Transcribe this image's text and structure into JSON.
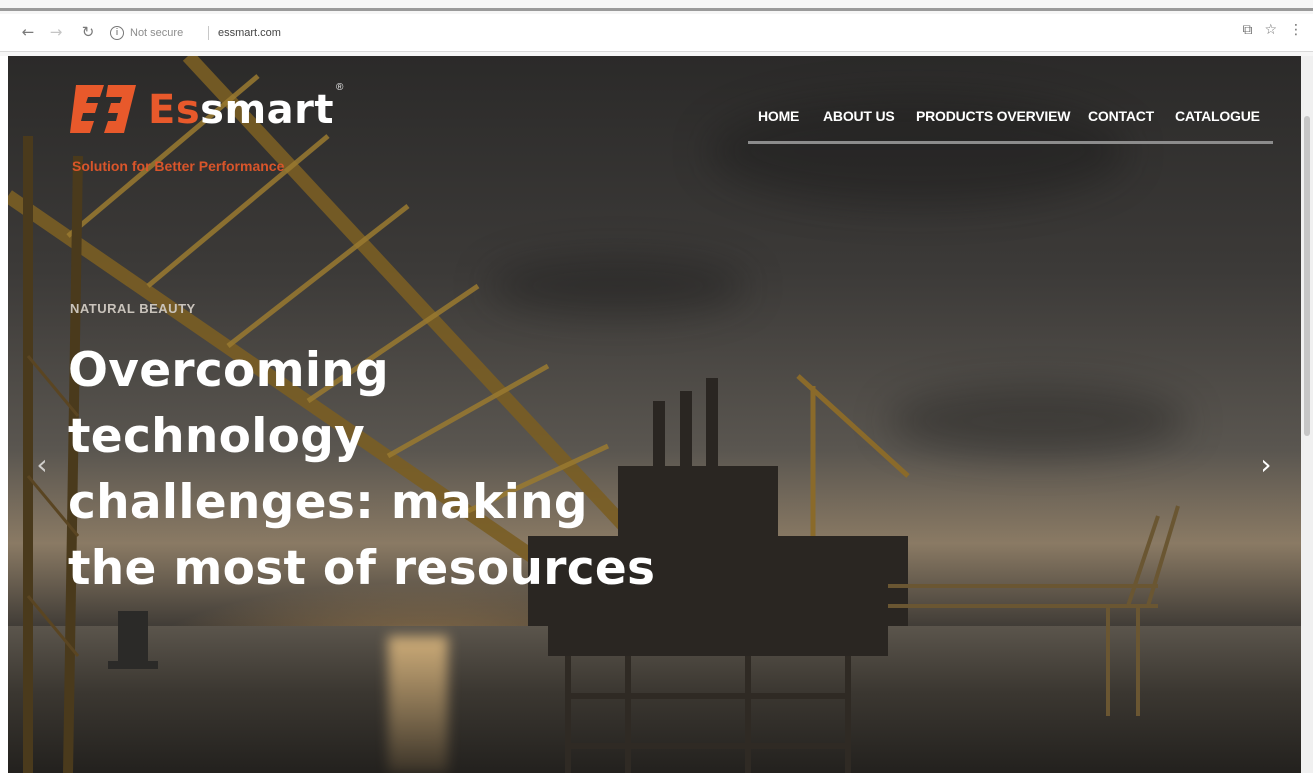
{
  "browser": {
    "back_icon": "back-arrow-icon",
    "forward_icon": "forward-arrow-icon",
    "reload_icon": "reload-icon",
    "security_label": "Not secure",
    "url": "essmart.com",
    "right_icons": [
      "translate-icon",
      "star-icon",
      "menu-icon"
    ]
  },
  "header": {
    "brand_prefix": "Es",
    "brand_suffix": "smart",
    "trademark": "®",
    "tagline": "Solution for Better Performance",
    "brand_color": "#e8592b"
  },
  "nav": {
    "items": [
      {
        "label": "HOME"
      },
      {
        "label": "ABOUT US"
      },
      {
        "label": "PRODUCTS OVERVIEW"
      },
      {
        "label": "CONTACT"
      },
      {
        "label": "CATALOGUE"
      }
    ]
  },
  "slide": {
    "kicker": "NATURAL BEAUTY",
    "headline_lines": [
      "Overcoming",
      "technology",
      "challenges: making",
      "the most of resources"
    ],
    "prev_glyph": "‹",
    "next_glyph": "›"
  }
}
